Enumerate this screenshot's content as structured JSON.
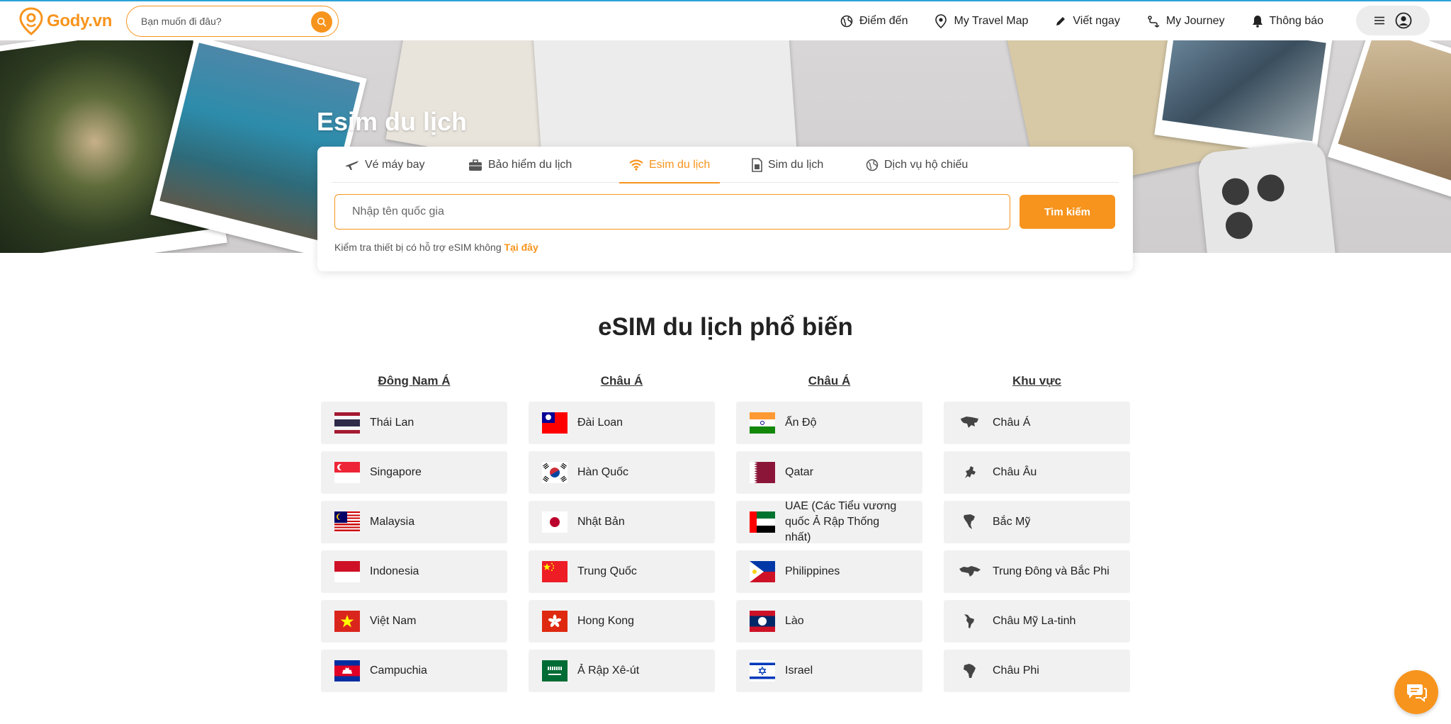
{
  "header": {
    "brand": "Gody.vn",
    "search_placeholder": "Bạn muốn đi đâu?",
    "nav": [
      {
        "label": "Điểm đến",
        "icon": "globe-icon"
      },
      {
        "label": "My Travel Map",
        "icon": "map-pin-icon"
      },
      {
        "label": "Viết ngay",
        "icon": "pencil-icon"
      },
      {
        "label": "My Journey",
        "icon": "route-icon"
      },
      {
        "label": "Thông báo",
        "icon": "bell-icon"
      }
    ]
  },
  "hero": {
    "title": "Esim du lịch"
  },
  "search_card": {
    "tabs": [
      {
        "label": "Vé máy bay",
        "icon": "airplane-icon",
        "active": false
      },
      {
        "label": "Bảo hiểm du lịch",
        "icon": "briefcase-icon",
        "active": false
      },
      {
        "label": "Esim du lịch",
        "icon": "wifi-icon",
        "active": true
      },
      {
        "label": "Sim du lịch",
        "icon": "sim-card-icon",
        "active": false
      },
      {
        "label": "Dịch vụ hộ chiếu",
        "icon": "passport-globe-icon",
        "active": false
      }
    ],
    "input_placeholder": "Nhập tên quốc gia",
    "submit_label": "Tìm kiếm",
    "check_text": "Kiểm tra thiết bị có hỗ trợ eSIM không",
    "check_link": "Tại đây"
  },
  "popular": {
    "title": "eSIM du lịch phổ biến",
    "columns": [
      {
        "heading": "Đông Nam Á",
        "items": [
          "Thái Lan",
          "Singapore",
          "Malaysia",
          "Indonesia",
          "Việt Nam",
          "Campuchia"
        ]
      },
      {
        "heading": "Châu Á",
        "items": [
          "Đài Loan",
          "Hàn Quốc",
          "Nhật Bản",
          "Trung Quốc",
          "Hong Kong",
          "Ả Rập Xê-út"
        ]
      },
      {
        "heading": "Châu Á",
        "items": [
          "Ấn Độ",
          "Qatar",
          "UAE (Các Tiểu vương quốc Ả Rập Thống nhất)",
          "Philippines",
          "Lào",
          "Israel"
        ]
      },
      {
        "heading": "Khu vực",
        "items": [
          "Châu Á",
          "Châu Âu",
          "Bắc Mỹ",
          "Trung Đông và Bắc Phi",
          "Châu Mỹ La-tinh",
          "Châu Phi"
        ]
      }
    ]
  },
  "colors": {
    "accent": "#f7941d",
    "text": "#222222",
    "tile_bg": "#f1f1f1"
  }
}
